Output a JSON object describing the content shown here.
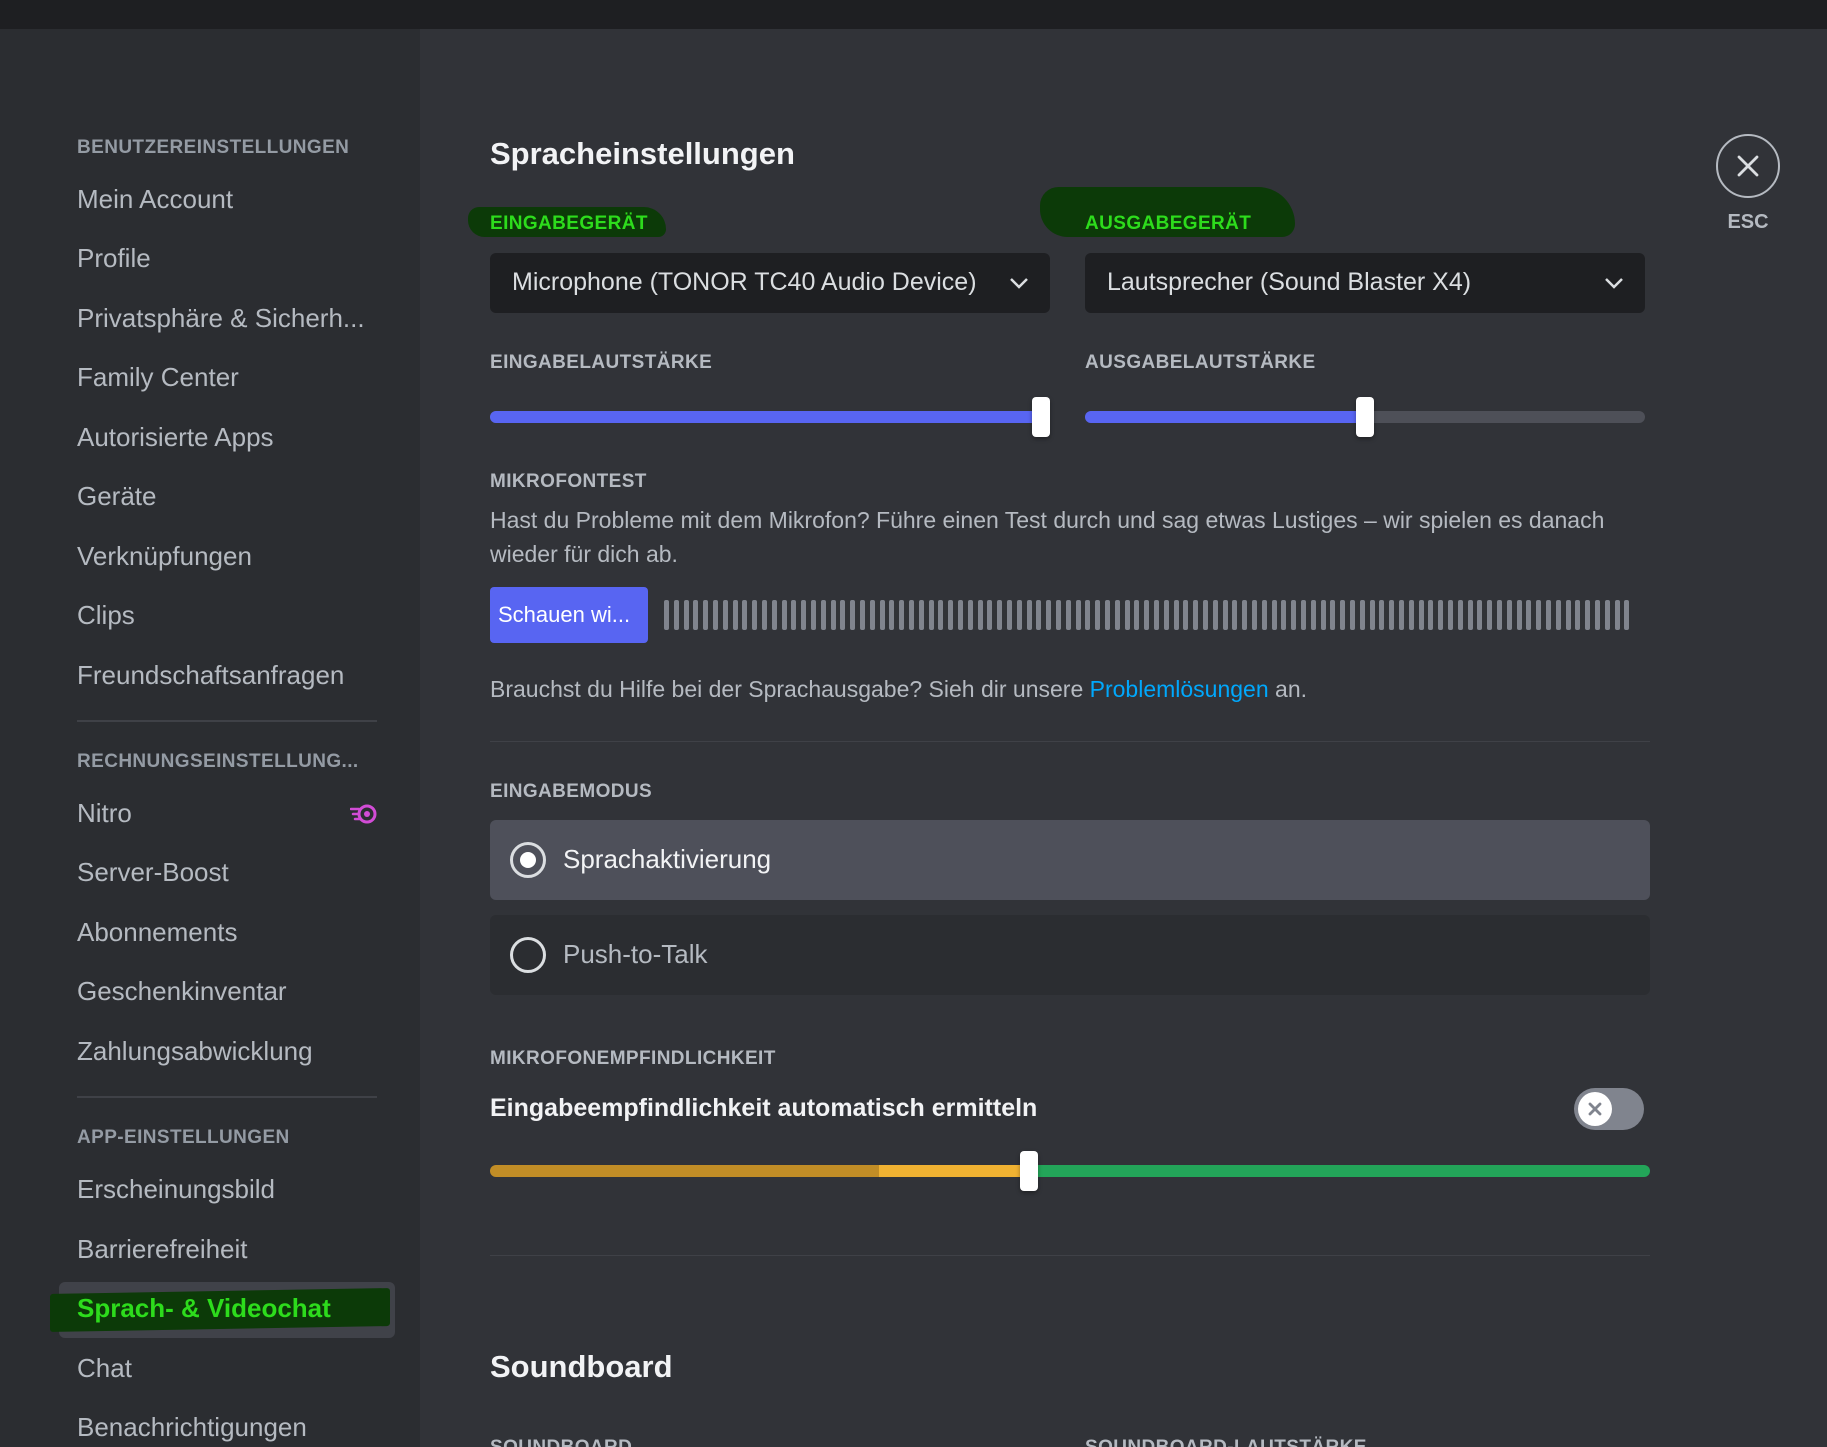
{
  "sidebar": {
    "sections": [
      {
        "header": "BENUTZEREINSTELLUNGEN",
        "items": [
          "Mein Account",
          "Profile",
          "Privatsphäre & Sicherh...",
          "Family Center",
          "Autorisierte Apps",
          "Geräte",
          "Verknüpfungen",
          "Clips",
          "Freundschaftsanfragen"
        ]
      },
      {
        "header": "RECHNUNGSEINSTELLUNG...",
        "items": [
          "Nitro",
          "Server-Boost",
          "Abonnements",
          "Geschenkinventar",
          "Zahlungsabwicklung"
        ]
      },
      {
        "header": "APP-EINSTELLUNGEN",
        "items": [
          "Erscheinungsbild",
          "Barrierefreiheit",
          "Sprach- & Videochat",
          "Chat",
          "Benachrichtigungen"
        ]
      }
    ],
    "active_item": "Sprach- & Videochat",
    "nitro_icon": "nitro-icon"
  },
  "main": {
    "title": "Spracheinstellungen",
    "input_device": {
      "label": "EINGABEGERÄT",
      "value": "Microphone (TONOR TC40 Audio Device)"
    },
    "output_device": {
      "label": "AUSGABEGERÄT",
      "value": "Lautsprecher (Sound Blaster X4)"
    },
    "input_volume": {
      "label": "EINGABELAUTSTÄRKE",
      "value_percent": 100
    },
    "output_volume": {
      "label": "AUSGABELAUTSTÄRKE",
      "value_percent": 50
    },
    "mic_test": {
      "label": "MIKROFONTEST",
      "description": "Hast du Probleme mit dem Mikrofon? Führe einen Test durch und sag etwas Lustiges – wir spielen es danach wieder für dich ab.",
      "button_label": "Schauen wi..."
    },
    "help": {
      "prefix": "Brauchst du Hilfe bei der Sprachausgabe? Sieh dir unsere ",
      "link": "Problemlösungen",
      "suffix": " an."
    },
    "input_mode": {
      "label": "EINGABEMODUS",
      "options": [
        "Sprachaktivierung",
        "Push-to-Talk"
      ],
      "selected": "Sprachaktivierung"
    },
    "sensitivity": {
      "label": "MIKROFONEMPFINDLICHKEIT",
      "auto_label": "Eingabeempfindlichkeit automatisch ermitteln",
      "auto_enabled": false,
      "threshold_percent": 46.5
    },
    "soundboard": {
      "title": "Soundboard",
      "label_left": "SOUNDBOARD",
      "label_right": "SOUNDBOARD-LAUTSTÄRKE"
    },
    "close": {
      "label": "ESC",
      "icon": "close-icon"
    }
  },
  "colors": {
    "accent": "#5865f2",
    "highlight_green": "#2ddc1c",
    "link": "#00a8fc",
    "sens_low": "#c18d26",
    "sens_mid": "#f0b232",
    "sens_high": "#23a559"
  }
}
